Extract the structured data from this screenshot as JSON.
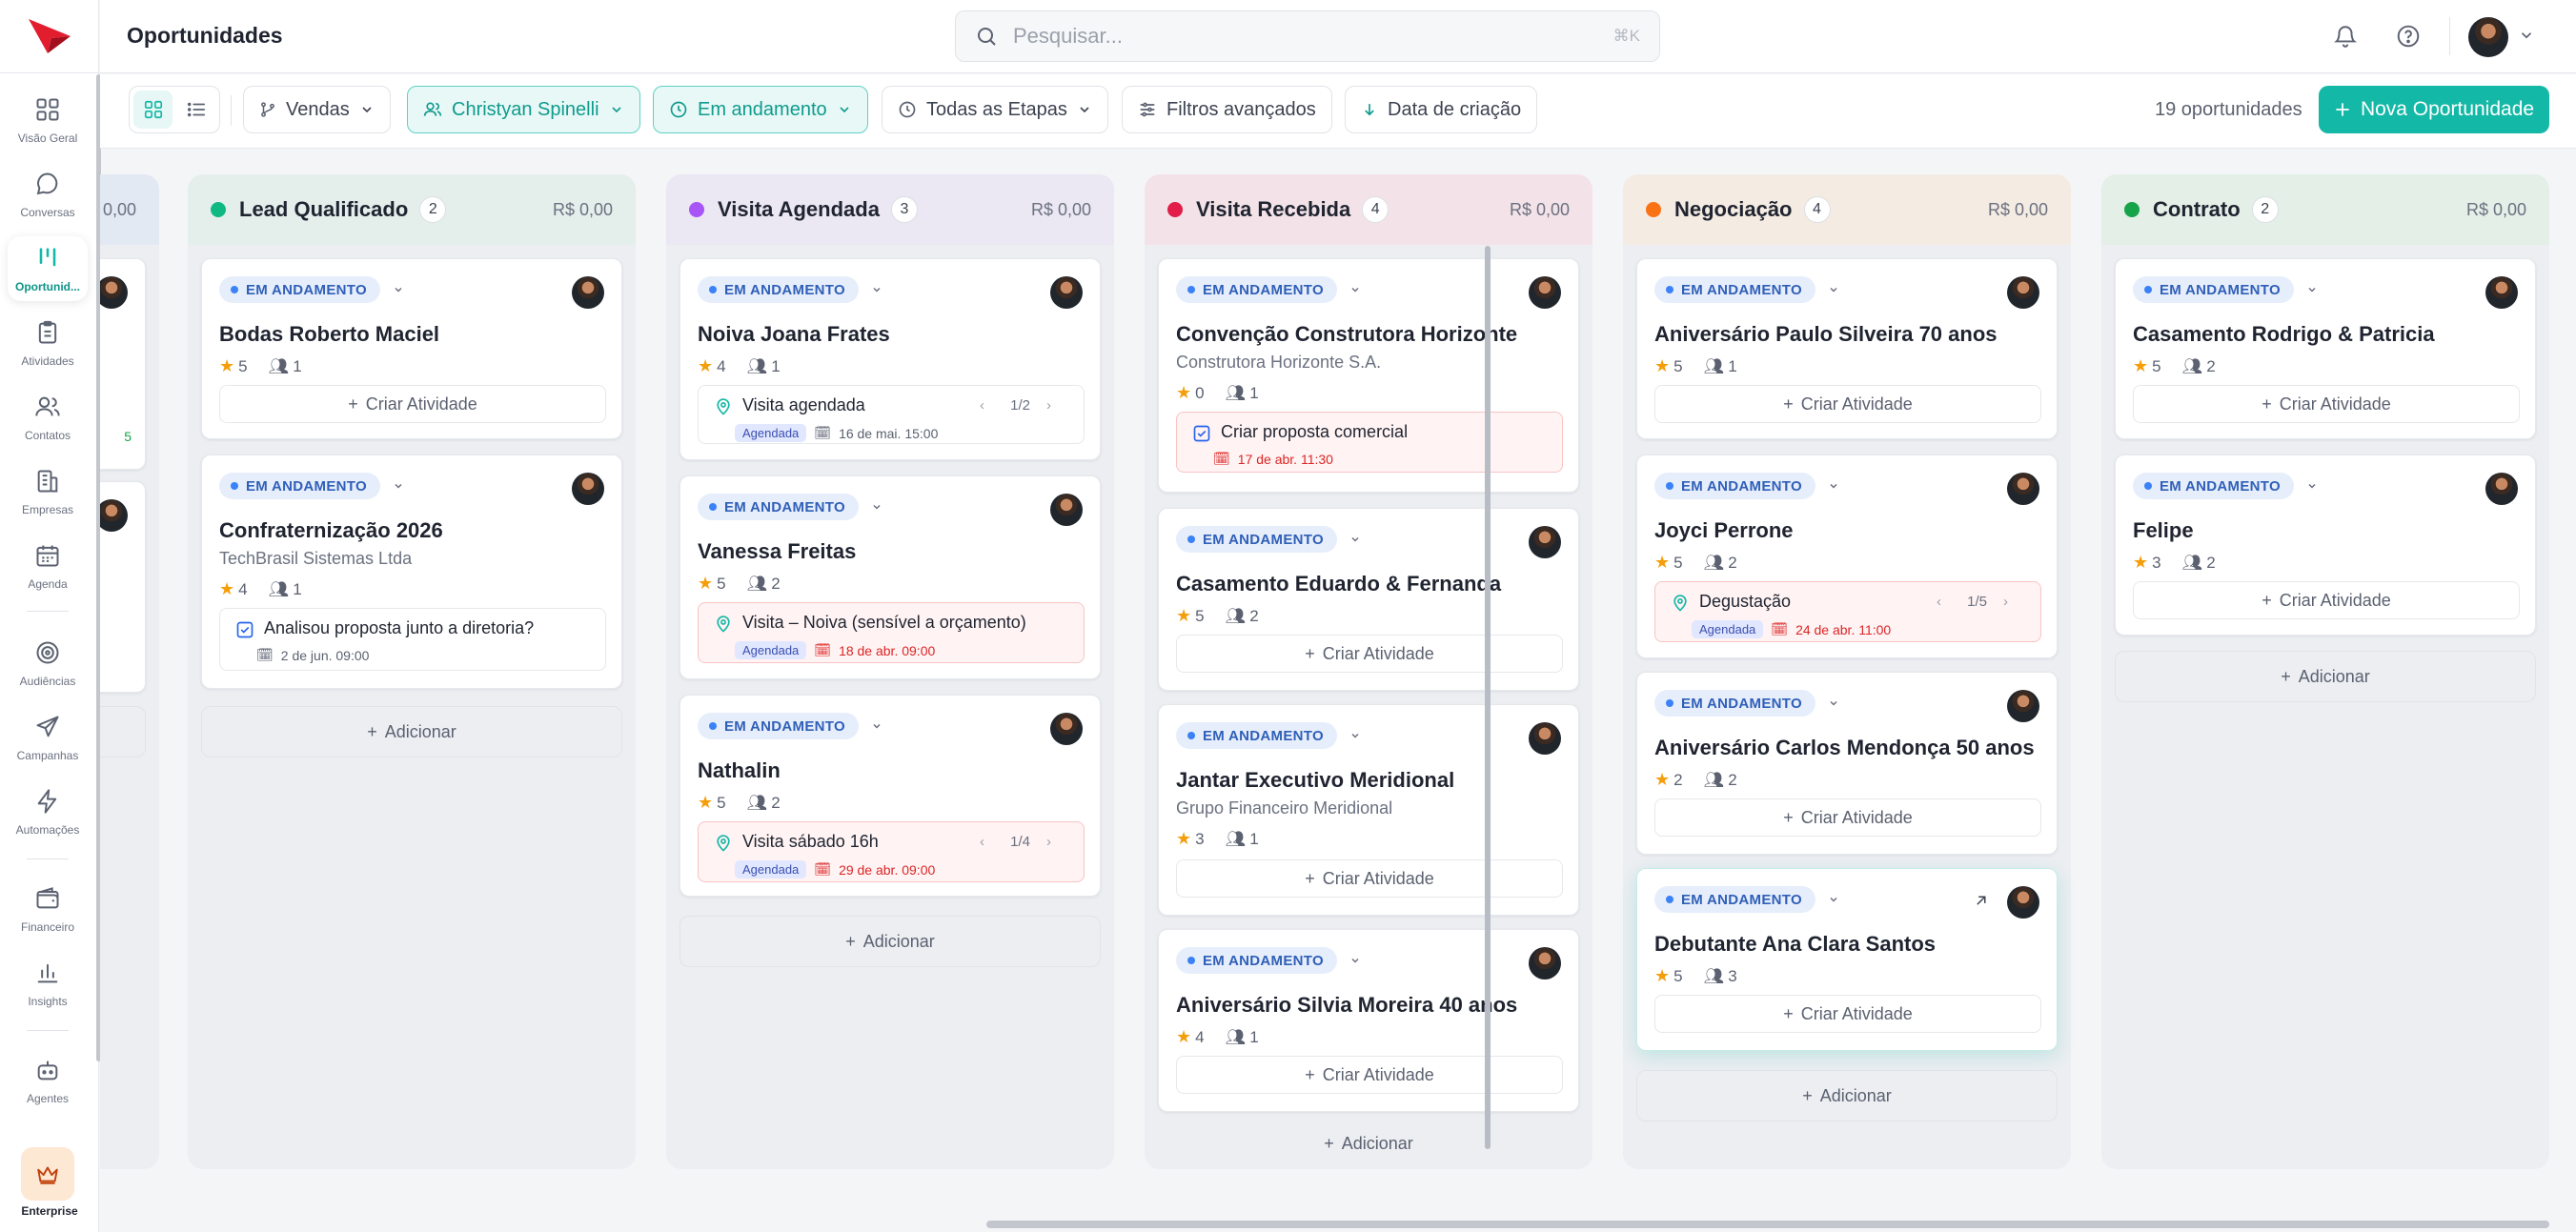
{
  "app": {
    "page_title": "Oportunidades",
    "search_placeholder": "Pesquisar...",
    "search_shortcut": "⌘K"
  },
  "sidebar": {
    "items": [
      {
        "label": "Visão Geral",
        "icon": "grid-icon"
      },
      {
        "label": "Conversas",
        "icon": "chat-icon"
      },
      {
        "label": "Oportunid...",
        "icon": "kanban-icon",
        "active": true
      },
      {
        "label": "Atividades",
        "icon": "clipboard-icon"
      },
      {
        "label": "Contatos",
        "icon": "users-icon"
      },
      {
        "label": "Empresas",
        "icon": "building-icon"
      },
      {
        "label": "Agenda",
        "icon": "calendar-icon"
      },
      {
        "label": "Audiências",
        "icon": "target-icon"
      },
      {
        "label": "Campanhas",
        "icon": "send-icon"
      },
      {
        "label": "Automações",
        "icon": "bolt-icon"
      },
      {
        "label": "Financeiro",
        "icon": "wallet-icon"
      },
      {
        "label": "Insights",
        "icon": "bar-chart-icon"
      },
      {
        "label": "Agentes",
        "icon": "bot-icon"
      }
    ],
    "enterprise_label": "Enterprise"
  },
  "filters": {
    "pipeline": "Vendas",
    "owner": "Christyan Spinelli",
    "status": "Em andamento",
    "stages": "Todas as Etapas",
    "advanced": "Filtros avançados",
    "sort": "Data de criação",
    "count_text": "19 oportunidades",
    "new_button": "Nova Oportunidade"
  },
  "colors": {
    "accent": "#14b8a6",
    "lead": "#10b981",
    "visita_agendada": "#a855f7",
    "visita_recebida": "#e11d48",
    "negociacao": "#f97316",
    "contrato": "#16a34a"
  },
  "columns": {
    "partial": {
      "total": "0,00",
      "value_fragment": "5"
    },
    "lead": {
      "title": "Lead Qualificado",
      "count": "2",
      "total": "R$ 0,00",
      "cards": [
        {
          "status": "EM ANDAMENTO",
          "title": "Bodas Roberto Maciel",
          "stars": "5",
          "people": "1",
          "create": "Criar Atividade"
        },
        {
          "status": "EM ANDAMENTO",
          "title": "Confraternização 2026",
          "subtitle": "TechBrasil Sistemas Ltda",
          "stars": "4",
          "people": "1",
          "activity": {
            "text": "Analisou proposta junto a diretoria?",
            "date": "2 de jun. 09:00"
          }
        }
      ],
      "add": "Adicionar"
    },
    "visita_agendada": {
      "title": "Visita Agendada",
      "count": "3",
      "total": "R$ 0,00",
      "cards": [
        {
          "status": "EM ANDAMENTO",
          "title": "Noiva Joana Frates",
          "stars": "4",
          "people": "1",
          "activity": {
            "text": "Visita agendada",
            "pager": "1/2",
            "badge": "Agendada",
            "date": "16 de mai. 15:00"
          }
        },
        {
          "status": "EM ANDAMENTO",
          "title": "Vanessa Freitas",
          "stars": "5",
          "people": "2",
          "activity": {
            "text": "Visita – Noiva (sensível a orçamento)",
            "badge": "Agendada",
            "date": "18 de abr. 09:00"
          }
        },
        {
          "status": "EM ANDAMENTO",
          "title": "Nathalin",
          "stars": "5",
          "people": "2",
          "activity": {
            "text": "Visita sábado 16h",
            "pager": "1/4",
            "badge": "Agendada",
            "date": "29 de abr. 09:00"
          }
        }
      ],
      "add": "Adicionar"
    },
    "visita_recebida": {
      "title": "Visita Recebida",
      "count": "4",
      "total": "R$ 0,00",
      "cards": [
        {
          "status": "EM ANDAMENTO",
          "title": "Convenção Construtora Horizonte",
          "subtitle": "Construtora Horizonte S.A.",
          "stars": "0",
          "people": "1",
          "activity": {
            "text": "Criar proposta comercial",
            "date": "17 de abr. 11:30"
          }
        },
        {
          "status": "EM ANDAMENTO",
          "title": "Casamento Eduardo & Fernanda",
          "stars": "5",
          "people": "2",
          "create": "Criar Atividade"
        },
        {
          "status": "EM ANDAMENTO",
          "title": "Jantar Executivo Meridional",
          "subtitle": "Grupo Financeiro Meridional",
          "stars": "3",
          "people": "1",
          "create": "Criar Atividade"
        },
        {
          "status": "EM ANDAMENTO",
          "title": "Aniversário Silvia Moreira 40 anos",
          "stars": "4",
          "people": "1",
          "create": "Criar Atividade"
        }
      ],
      "add": "Adicionar"
    },
    "negociacao": {
      "title": "Negociação",
      "count": "4",
      "total": "R$ 0,00",
      "cards": [
        {
          "status": "EM ANDAMENTO",
          "title": "Aniversário Paulo Silveira 70 anos",
          "stars": "5",
          "people": "1",
          "create": "Criar Atividade"
        },
        {
          "status": "EM ANDAMENTO",
          "title": "Joyci Perrone",
          "stars": "5",
          "people": "2",
          "activity": {
            "text": "Degustação",
            "pager": "1/5",
            "badge": "Agendada",
            "date": "24 de abr. 11:00"
          }
        },
        {
          "status": "EM ANDAMENTO",
          "title": "Aniversário Carlos Mendonça 50 anos",
          "stars": "2",
          "people": "2",
          "create": "Criar Atividade"
        },
        {
          "status": "EM ANDAMENTO",
          "title": "Debutante Ana Clara Santos",
          "stars": "5",
          "people": "3",
          "create": "Criar Atividade"
        }
      ],
      "add": "Adicionar"
    },
    "contrato": {
      "title": "Contrato",
      "count": "2",
      "total": "R$ 0,00",
      "cards": [
        {
          "status": "EM ANDAMENTO",
          "title": "Casamento Rodrigo & Patricia",
          "stars": "5",
          "people": "2",
          "create": "Criar Atividade"
        },
        {
          "status": "EM ANDAMENTO",
          "title": "Felipe",
          "stars": "3",
          "people": "2",
          "create": "Criar Atividade"
        }
      ],
      "add": "Adicionar"
    }
  }
}
